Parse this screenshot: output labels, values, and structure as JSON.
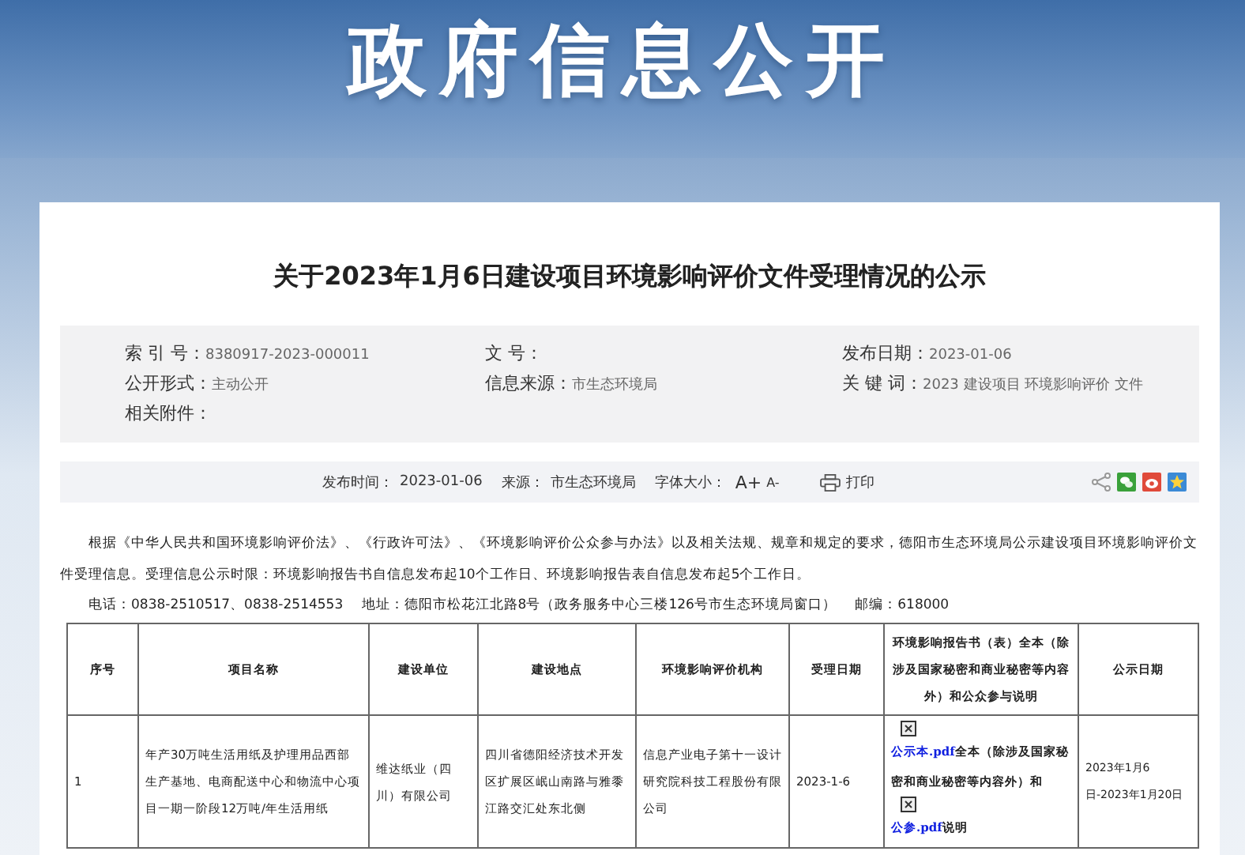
{
  "banner": {
    "title": "政府信息公开"
  },
  "article": {
    "title": "关于2023年1月6日建设项目环境影响评价文件受理情况的公示"
  },
  "meta": [
    {
      "label": "索 引 号：",
      "value": "8380917-2023-000011"
    },
    {
      "label": "文 号："
    },
    {
      "label": "发布日期：",
      "value": "2023-01-06"
    },
    {
      "label": "公开形式：",
      "value": "主动公开"
    },
    {
      "label": "信息来源：",
      "value": "市生态环境局"
    },
    {
      "label": "关 键 词：",
      "value": "2023 建设项目 环境影响评价 文件"
    },
    {
      "label": "相关附件："
    }
  ],
  "toolbar": {
    "publish_label": "发布时间：",
    "publish_time": "2023-01-06",
    "source_label": "来源：",
    "source": "市生态环境局",
    "font_label": "字体大小：",
    "font_larger": "A+",
    "font_smaller": "A-",
    "print": "打印"
  },
  "body": {
    "paragraph": "根据《中华人民共和国环境影响评价法》、《行政许可法》、《环境影响评价公众参与办法》以及相关法规、规章和规定的要求，德阳市生态环境局公示建设项目环境影响评价文件受理信息。受理信息公示时限：环境影响报告书自信息发布起10个工作日、环境影响报告表自信息发布起5个工作日。",
    "contact": "电话：0838-2510517、0838-2514553　 地址：德阳市松花江北路8号（政务服务中心三楼126号市生态环境局窗口）　 邮编：618000"
  },
  "table": {
    "columns": [
      "序号",
      "项目名称",
      "建设单位",
      "建设地点",
      "环境影响评价机构",
      "受理日期",
      "环境影响报告书（表）全本（除涉及国家秘密和商业秘密等内容外）和公众参与说明",
      "公示日期"
    ],
    "rows": [
      {
        "cells": [
          "1",
          "年产30万吨生活用纸及护理用品西部生产基地、电商配送中心和物流中心项目一期一阶段12万吨/年生活用纸",
          "维达纸业（四川）有限公司",
          "四川省德阳经济技术开发区扩展区岷山南路与雅黍江路交汇处东北侧",
          "信息产业电子第十一设计研究院科技工程股份有限公司",
          "2023-1-6"
        ],
        "attachments": [
          {
            "file": "公示本.pdf",
            "text": "全本（除涉及国家秘密和商业秘密等内容外）和"
          },
          {
            "file": "公参.pdf",
            "text": "说明"
          }
        ],
        "date": "2023年1月6日-2023年1月20日"
      }
    ]
  }
}
